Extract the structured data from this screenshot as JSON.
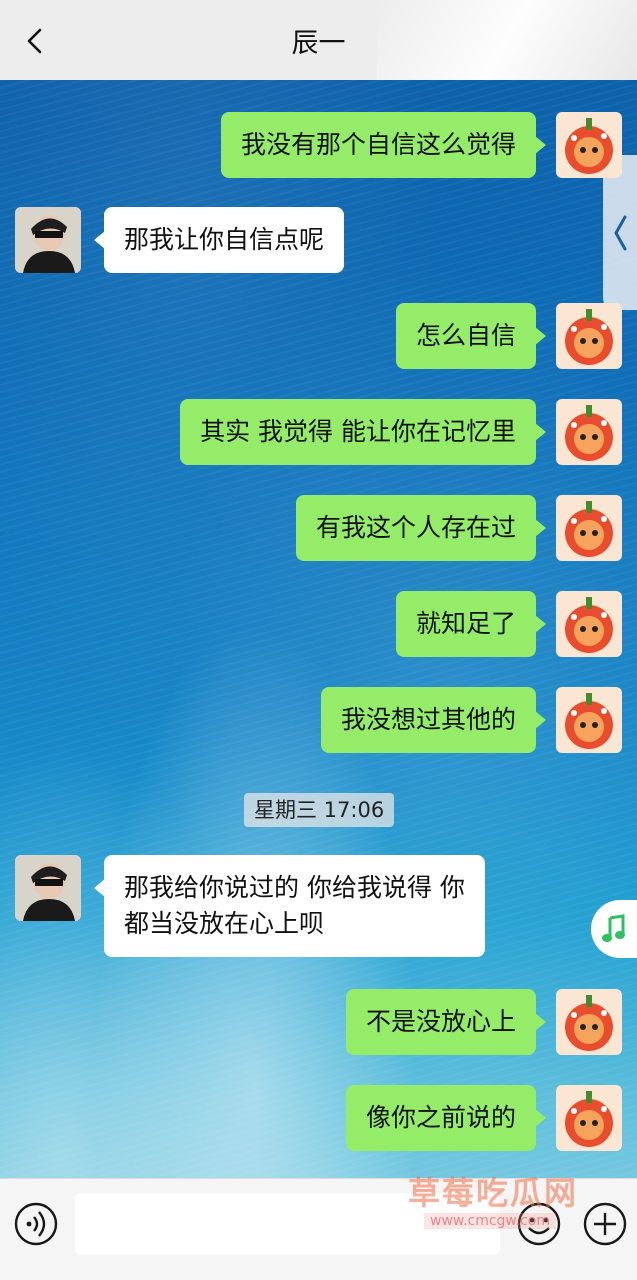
{
  "header": {
    "title": "辰一"
  },
  "messages": [
    {
      "side": "out",
      "text": "我没有那个自信这么觉得"
    },
    {
      "side": "in",
      "text": "那我让你自信点呢"
    },
    {
      "side": "out",
      "text": "怎么自信"
    },
    {
      "side": "out",
      "text": "其实 我觉得 能让你在记忆里"
    },
    {
      "side": "out",
      "text": "有我这个人存在过"
    },
    {
      "side": "out",
      "text": "就知足了"
    },
    {
      "side": "out",
      "text": "我没想过其他的"
    },
    {
      "side": "in",
      "text_line1": "那我给你说过的 你给我说得 你",
      "text_line2": "都当没放在心上呗"
    },
    {
      "side": "out",
      "text": "不是没放心上"
    },
    {
      "side": "out",
      "text": "像你之前说的"
    }
  ],
  "timestamp": "星期三 17:06",
  "watermark": {
    "text": "草莓吃瓜网",
    "url": "www.cmcgw.com"
  },
  "icons": {
    "back": "chevron-left-icon",
    "voice": "voice-icon",
    "emoji": "emoji-icon",
    "plus": "plus-icon",
    "music": "music-note-icon"
  },
  "colors": {
    "outgoing_bubble": "#95ec69",
    "incoming_bubble": "#ffffff",
    "music_note": "#2dbf62"
  }
}
